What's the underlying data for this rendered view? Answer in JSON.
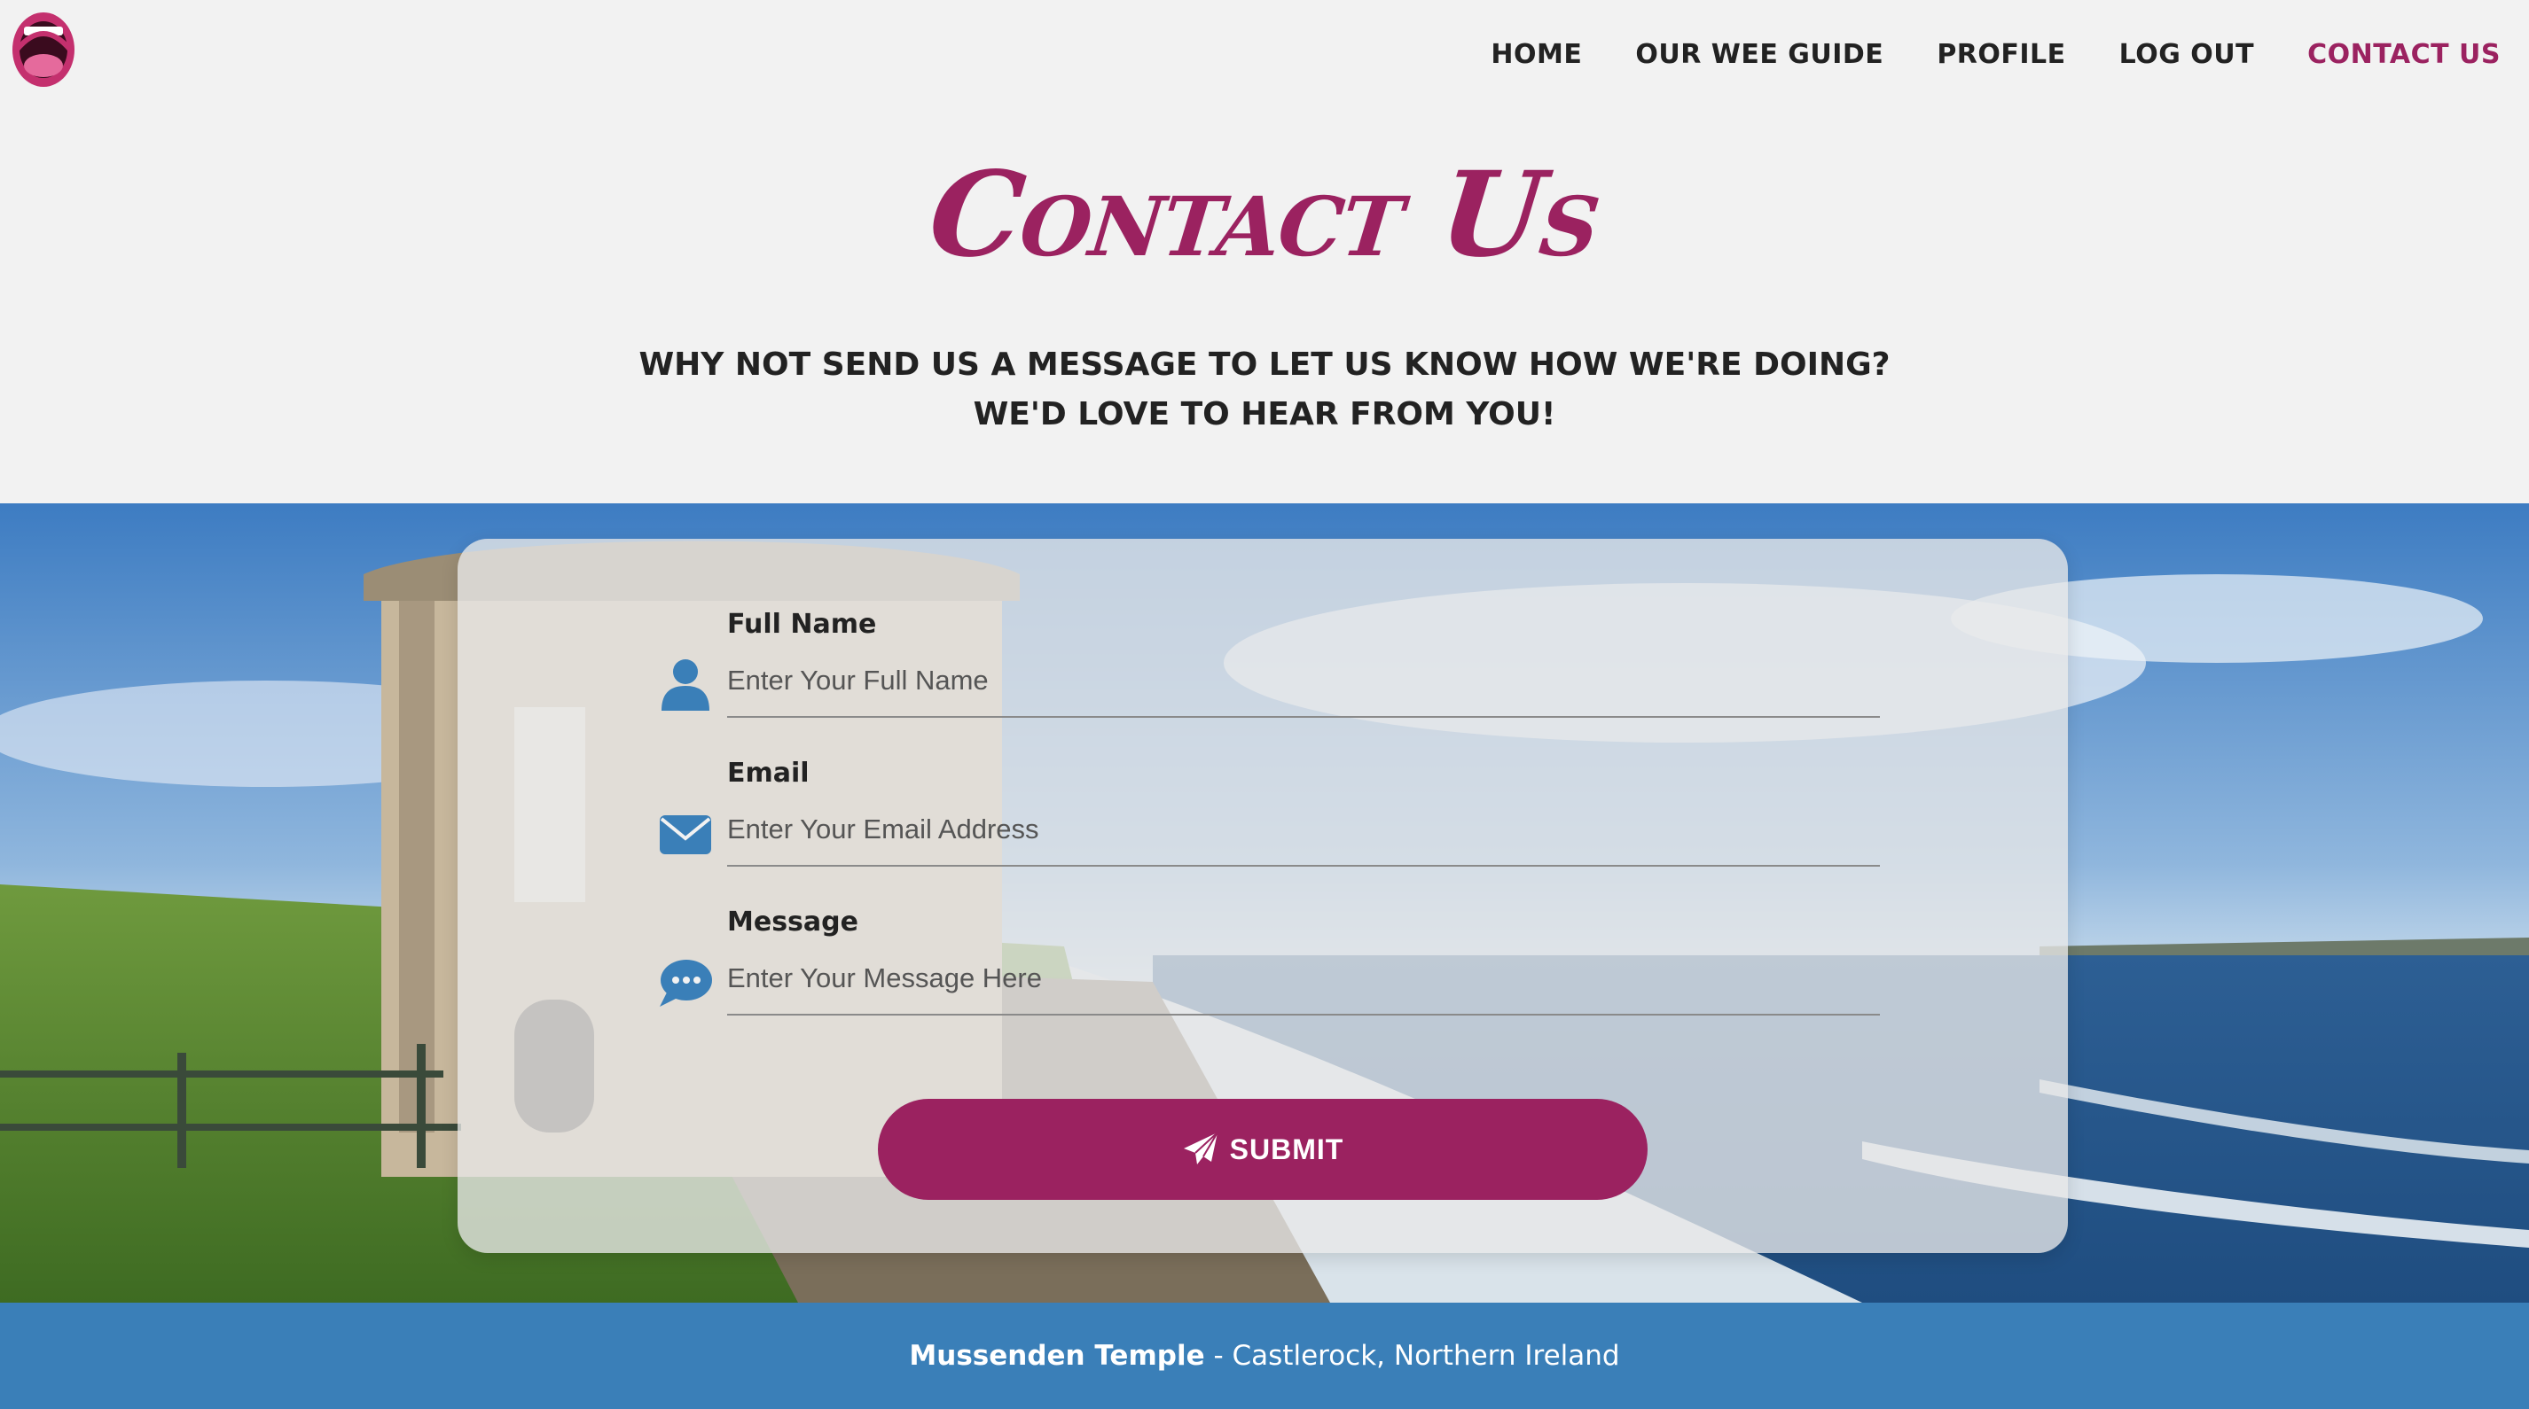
{
  "nav": {
    "items": [
      {
        "label": "HOME"
      },
      {
        "label": "OUR WEE GUIDE"
      },
      {
        "label": "PROFILE"
      },
      {
        "label": "LOG OUT"
      },
      {
        "label": "CONTACT US",
        "active": true
      }
    ]
  },
  "logo": {
    "icon": "open-mouth-logo"
  },
  "page": {
    "title": "Contact Us",
    "subtitle_line1": "WHY NOT SEND US A MESSAGE TO LET US KNOW HOW WE'RE DOING?",
    "subtitle_line2": "WE'D LOVE TO HEAR FROM YOU!"
  },
  "form": {
    "full_name": {
      "label": "Full Name",
      "placeholder": "Enter Your Full Name",
      "icon": "user-icon"
    },
    "email": {
      "label": "Email",
      "placeholder": "Enter Your Email Address",
      "icon": "envelope-icon"
    },
    "message": {
      "label": "Message",
      "placeholder": "Enter Your Message Here",
      "icon": "speech-bubble-icon"
    },
    "submit_label": "SUBMIT"
  },
  "footer": {
    "place": "Mussenden Temple",
    "separator": " - ",
    "location": "Castlerock, Northern Ireland"
  },
  "colors": {
    "accent": "#9b2260",
    "icon_blue": "#3a7fb8",
    "footer_bg": "#3a7fb8",
    "page_bg": "#f2f2f2"
  }
}
